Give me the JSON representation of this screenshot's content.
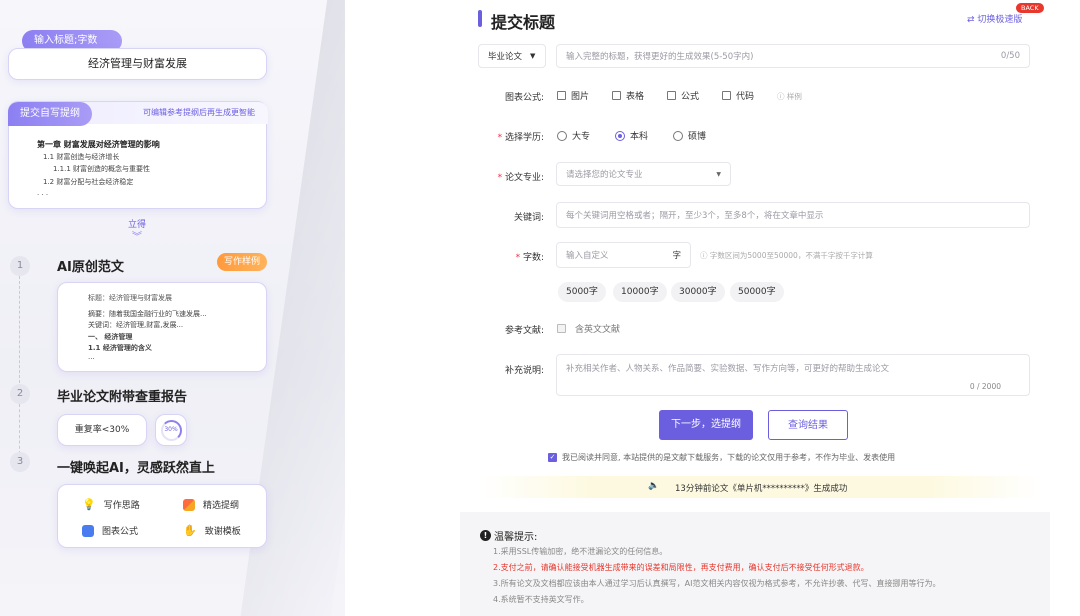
{
  "left": {
    "step_input": {
      "tag": "输入标题;字数",
      "value": "经济管理与财富发展"
    },
    "outline": {
      "tag": "提交自写提纲",
      "hint": "可编辑参考提纲后再生成更智能",
      "chapter": "第一章 财富发展对经济管理的影响",
      "l1": "1.1 财富创造与经济增长",
      "l2": "1.1.1 财富创造的概念与重要性",
      "l3": "1.2 财富分配与社会经济稳定",
      "more": ". . .",
      "expand": "立得"
    },
    "steps": [
      {
        "num": "1",
        "title": "AI原创范文",
        "tag": "写作样例",
        "sample": {
          "title": "标题：经济管理与财富发展",
          "abstract": "摘要：随着我国金融行业的飞速发展...",
          "keywords": "关键词：经济管理,财富,发展...",
          "sec": "一、 经济管理",
          "sub": "1.1 经济管理的含义",
          "more": "..."
        }
      },
      {
        "num": "2",
        "title": "毕业论文附带查重报告",
        "rate": "重复率<30%",
        "ring": "30%"
      },
      {
        "num": "3",
        "title": "一键唤起AI，灵感跃然直上",
        "features": [
          "写作思路",
          "精选提纲",
          "图表公式",
          "致谢模板"
        ]
      }
    ]
  },
  "right": {
    "title": "提交标题",
    "back_badge": "BACK",
    "switch": "切换极速版",
    "type_select": "毕业论文",
    "title_placeholder": "输入完整的标题，获得更好的生成效果(5-50字内)",
    "title_count": "0/50",
    "chart_label": "图表公式:",
    "chart_opts": [
      "图片",
      "表格",
      "公式",
      "代码"
    ],
    "sample_link": "ⓘ 样例",
    "edu_label": "选择学历:",
    "edu_opts": [
      "大专",
      "本科",
      "硕博"
    ],
    "major_label": "论文专业:",
    "major_placeholder": "请选择您的论文专业",
    "kw_label": "关键词:",
    "kw_placeholder": "每个关键词用空格或者；隔开，至少3个，至多8个，将在文章中显示",
    "words_label": "字数:",
    "words_placeholder": "输入自定义",
    "words_unit": "字",
    "words_hint": "ⓘ 字数区间为5000至50000，不满千字按千字计算",
    "word_chips": [
      "5000字",
      "10000字",
      "30000字",
      "50000字"
    ],
    "ref_label": "参考文献:",
    "ref_opt": "含英文文献",
    "extra_label": "补充说明:",
    "extra_placeholder": "补充相关作者、人物关系、作品简要、实验数据、写作方向等，可更好的帮助生成论文",
    "extra_count": "0 / 2000",
    "next_btn": "下一步，选提纲",
    "query_btn": "查询结果",
    "agree": "我已阅读并同意, 本站提供的是文献下载服务，下载的论文仅用于参考，不作为毕业、发表使用",
    "ticker": "13分钟前论文《单片机**********》生成成功",
    "notice_title": "温馨提示:",
    "notices": [
      "1.采用SSL传输加密，绝不泄漏论文的任何信息。",
      "2.支付之前，请确认能接受机器生成带来的误差和局限性，再支付费用，确认支付后不接受任何形式退款。",
      "3.所有论文及文档都应该由本人通过学习后认真撰写，AI范文相关内容仅视为格式参考，不允许抄袭、代写、直接挪用等行为。",
      "4.系统暂不支持英文写作。"
    ],
    "colors": {
      "accent": "#6b5fe0",
      "warning": "#e8372c"
    }
  }
}
